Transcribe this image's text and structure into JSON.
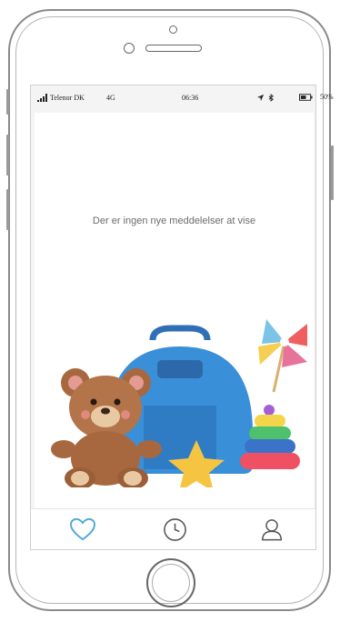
{
  "status_bar": {
    "carrier": "Telenor DK",
    "network": "4G",
    "time": "06:36",
    "battery": "50%"
  },
  "main": {
    "empty_message": "Der er ingen nye meddelelser at vise"
  },
  "tabbar": {
    "items": [
      {
        "icon": "heart-icon",
        "active": true
      },
      {
        "icon": "clock-icon",
        "active": false
      },
      {
        "icon": "profile-icon",
        "active": false
      }
    ]
  },
  "colors": {
    "accent": "#4aa8d8",
    "inactive_icon": "#555555"
  }
}
